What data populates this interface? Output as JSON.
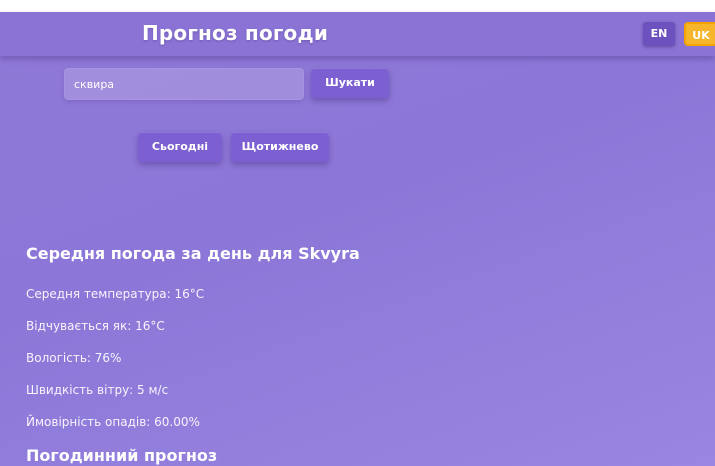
{
  "header": {
    "title": "Прогноз погоди",
    "languages": [
      {
        "code": "EN",
        "active": false
      },
      {
        "code": "UK",
        "active": true
      }
    ]
  },
  "search": {
    "value": "сквира",
    "button_label": "Шукати"
  },
  "view_toggle": {
    "today_label": "Сьогодні",
    "weekly_label": "Щотижнево"
  },
  "daily_summary": {
    "title": "Середня погода за день для Skvyra",
    "stats": [
      "Середня температура: 16°C",
      "Відчувається як: 16°C",
      "Вологість: 76%",
      "Швидкість вітру: 5 м/с",
      "Ймовірність опадів: 60.00%"
    ]
  },
  "forecast": {
    "title": "Погодинний прогноз"
  },
  "colors": {
    "background": "#8c77d8",
    "header": "#8a73d4",
    "button": "#7c5fd0",
    "lang_active": "#f7b52c",
    "lang_inactive": "#6d52bf"
  }
}
